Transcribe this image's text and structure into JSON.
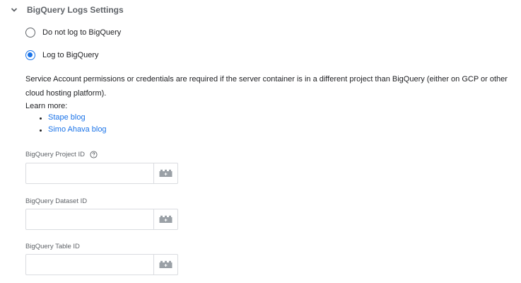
{
  "section": {
    "title": "BigQuery Logs Settings",
    "expanded": true
  },
  "radio_options": [
    {
      "label": "Do not log to BigQuery",
      "checked": false
    },
    {
      "label": "Log to BigQuery",
      "checked": true
    }
  ],
  "info": {
    "text": "Service Account permissions or credentials are required if the server container is in a different project than BigQuery (either on GCP or other cloud hosting platform).",
    "learn_more": "Learn more:",
    "links": [
      {
        "label": "Stape blog"
      },
      {
        "label": "Simo Ahava blog"
      }
    ]
  },
  "fields": {
    "project_id": {
      "label": "BigQuery Project ID",
      "value": "",
      "has_help": true
    },
    "dataset_id": {
      "label": "BigQuery Dataset ID",
      "value": ""
    },
    "table_id": {
      "label": "BigQuery Table ID",
      "value": ""
    }
  },
  "colors": {
    "accent": "#1a73e8",
    "label_gray": "#5f6368",
    "border": "#dadce0",
    "icon_gray": "#9aa0a6"
  },
  "icons": {
    "section_toggle": "chevron-down-icon",
    "help": "help-circle-icon",
    "variable": "variable-brick-icon"
  }
}
